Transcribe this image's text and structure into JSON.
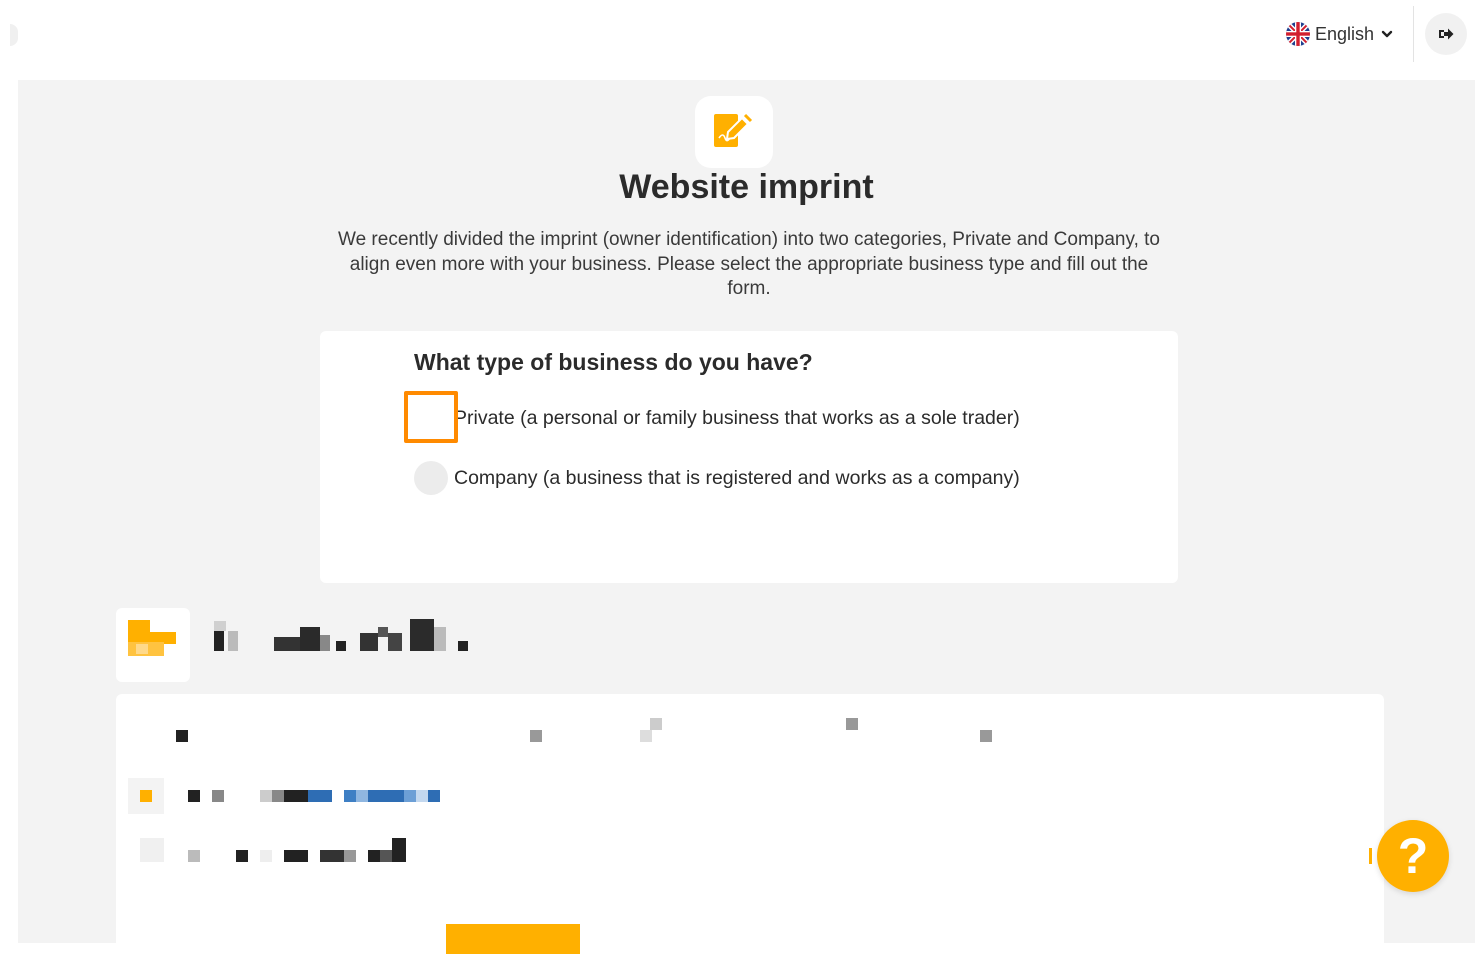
{
  "header": {
    "language": {
      "label": "English",
      "flag_icon": "uk-flag-icon",
      "dropdown_icon": "chevron-down-icon"
    },
    "logout_icon": "sign-out-icon"
  },
  "page": {
    "icon": "signature-document-icon",
    "title": "Website imprint",
    "intro": "We recently divided the imprint (owner identification) into two categories, Private and Company, to align even more with your business. Please select the appropriate business type and fill out the form."
  },
  "business_type": {
    "question": "What type of business do you have?",
    "options": [
      {
        "label": "Private (a personal or family business that works as a sole trader)",
        "selected": false,
        "highlighted": true
      },
      {
        "label": "Company (a business that is registered and works as a company)",
        "selected": false,
        "highlighted": false
      }
    ]
  },
  "help_button": {
    "glyph": "?"
  },
  "colors": {
    "accent": "#ffb000",
    "highlight": "#ff8a00",
    "background": "#f3f3f3",
    "card": "#ffffff",
    "text": "#2b2b2b"
  }
}
